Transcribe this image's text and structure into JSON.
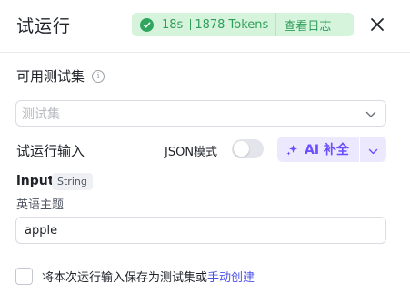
{
  "header": {
    "title": "试运行",
    "status": {
      "time": "18s",
      "tokens": "1878 Tokens",
      "view_log": "查看日志"
    }
  },
  "test_set": {
    "label": "可用测试集",
    "placeholder": "测试集"
  },
  "run_input": {
    "label": "试运行输入",
    "json_mode_label": "JSON模式",
    "json_mode_on": false,
    "ai_button_label": "AI 补全"
  },
  "field": {
    "name": "input",
    "type": "String",
    "description": "英语主题",
    "value": "apple"
  },
  "footer": {
    "save_text": "将本次运行输入保存为测试集或",
    "manual_link": "手动创建"
  },
  "colors": {
    "success_bg": "#d6f3dc",
    "success_text": "#2f9e5a",
    "ai_bg": "#ece9ff",
    "ai_text": "#6b4eff",
    "link": "#4d53e8"
  }
}
